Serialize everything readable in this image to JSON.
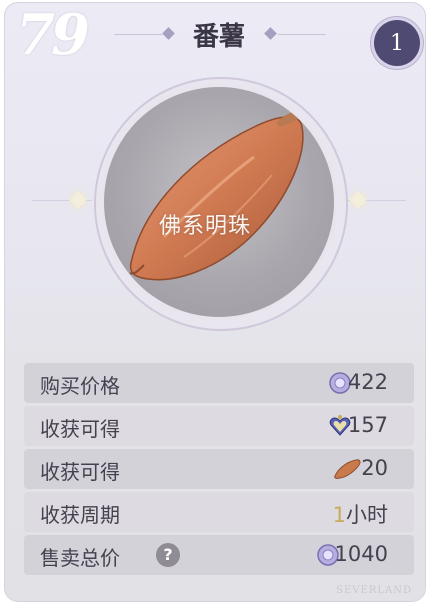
{
  "corner_number": "79",
  "item": {
    "name": "番薯",
    "level": "1",
    "watermark": "佛系明珠",
    "icon": "sweet-potato"
  },
  "stats": [
    {
      "label": "购买价格",
      "value": "422",
      "icon": "coin-icon"
    },
    {
      "label": "收获可得",
      "value": "157",
      "icon": "heart-gem-icon"
    },
    {
      "label": "收获可得",
      "value": "20",
      "icon": "sweet-potato-icon"
    },
    {
      "label": "收获周期",
      "value_num": "1",
      "value_unit": "小时"
    },
    {
      "label": "售卖总价",
      "value": "1040",
      "icon": "coin-icon",
      "help": "?"
    }
  ],
  "footer": "SEVERLAND",
  "colors": {
    "badge": "#4f4a72",
    "accent_gold": "#c8aa5a",
    "text": "#45414f"
  }
}
